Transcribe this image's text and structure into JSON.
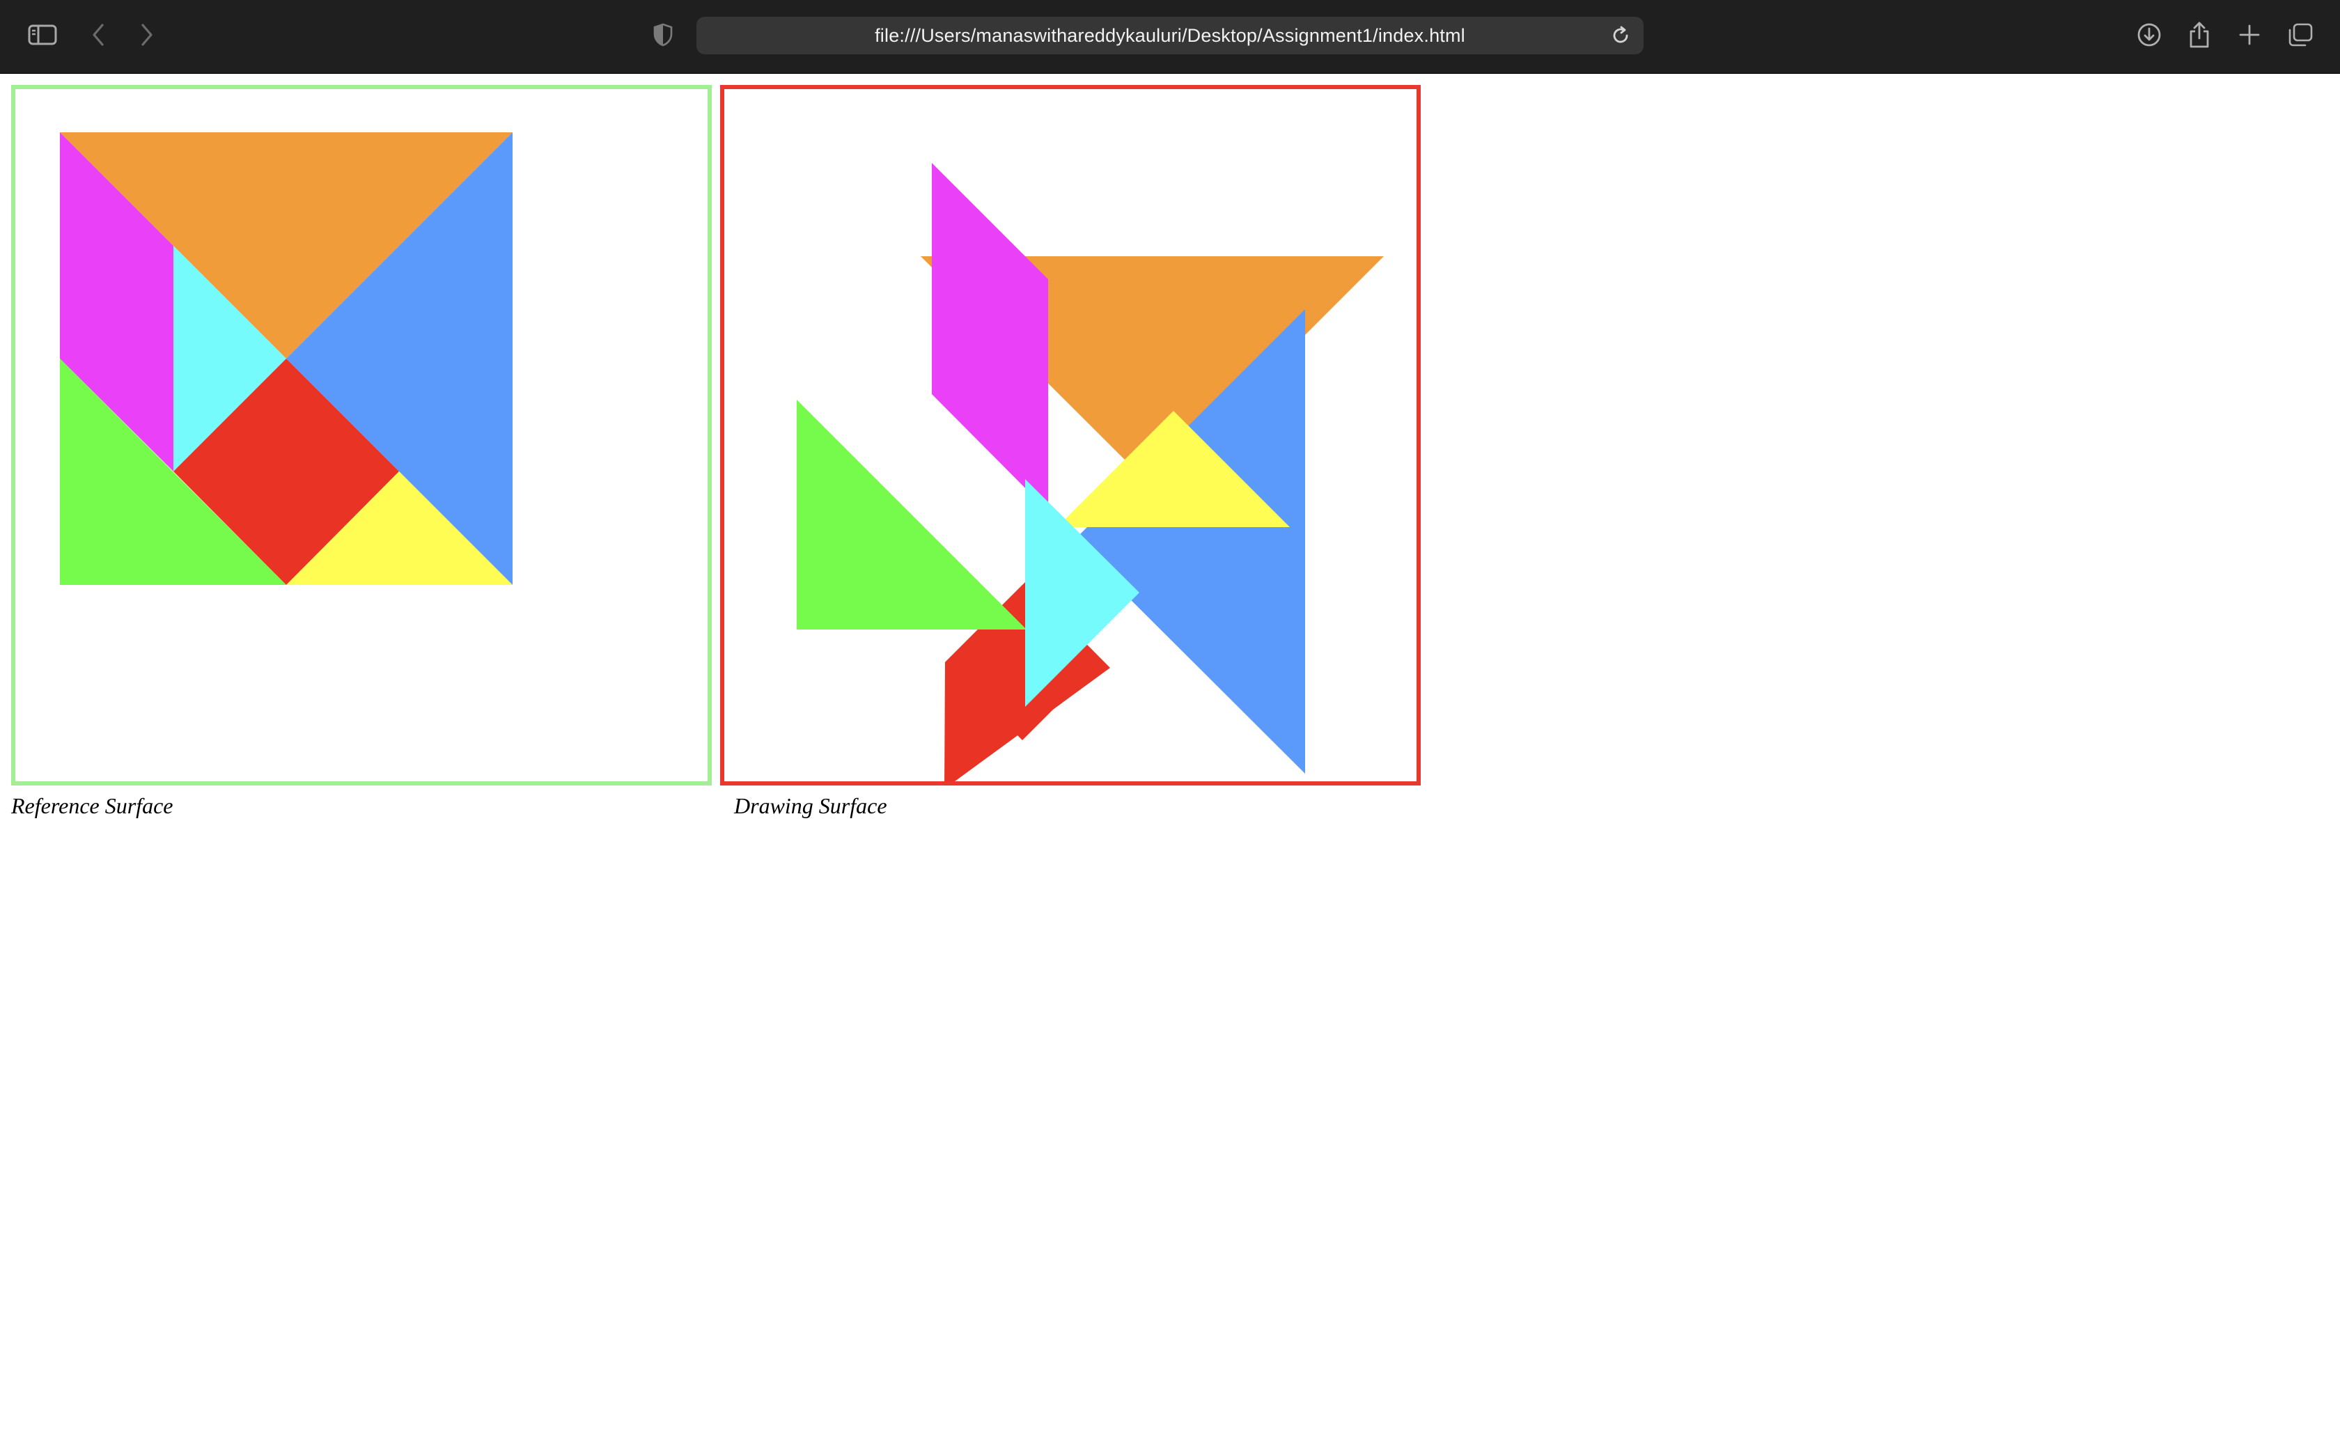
{
  "browser": {
    "url": "file:///Users/manaswithareddykauluri/Desktop/Assignment1/index.html",
    "icons": {
      "sidebar": "sidebar-icon",
      "back": "chevron-left-icon",
      "forward": "chevron-right-icon",
      "privacy": "shield-icon",
      "reload": "reload-icon",
      "downloads": "download-icon",
      "share": "share-icon",
      "new_tab": "plus-icon",
      "tabs": "tab-overview-icon"
    },
    "toolbar_color": "#1f1f1f",
    "address_bar_color": "#363636"
  },
  "page": {
    "reference_caption": "Reference Surface",
    "drawing_caption": "Drawing Surface",
    "reference_border_color": "#a2ee95",
    "drawing_border_color": "#e9382d"
  },
  "tangram_colors": {
    "orange": "#f09c3a",
    "blue": "#5b99fa",
    "magenta": "#ea40f7",
    "cyan": "#75fbfb",
    "red": "#e93324",
    "green": "#76fb4c",
    "yellow": "#fffd54"
  }
}
